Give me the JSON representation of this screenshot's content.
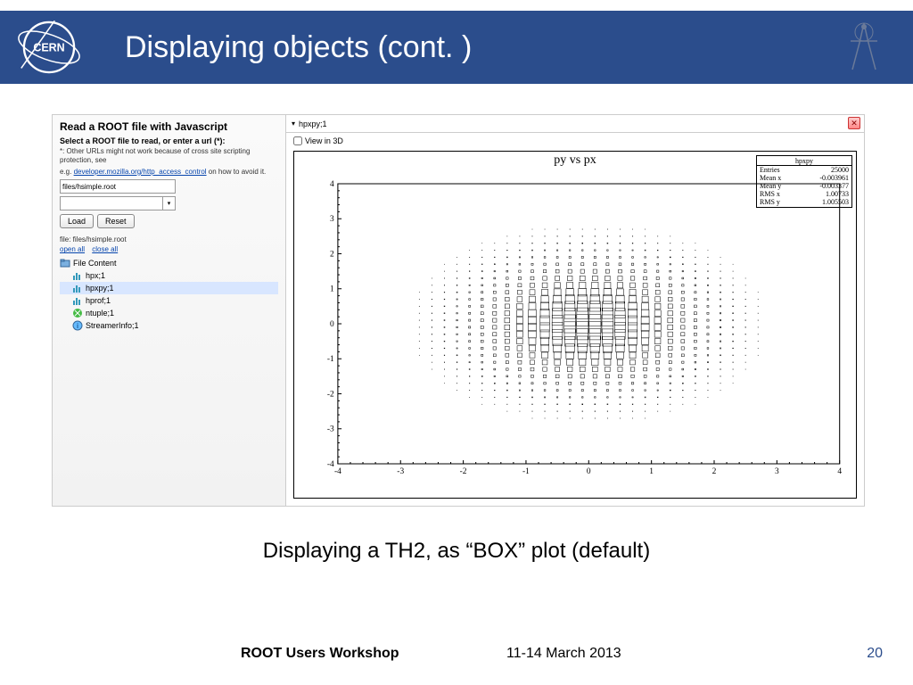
{
  "header": {
    "title": "Displaying objects (cont. )"
  },
  "left": {
    "title": "Read a ROOT file with Javascript",
    "subtitle": "Select a ROOT file to read, or enter a url (*):",
    "note1": "*: Other URLs might not work because of cross site scripting protection, see",
    "note_link": "developer.mozilla.org/http_access_control",
    "note2": " on how to avoid it.",
    "url_value": "files/hsimple.root",
    "load": "Load",
    "reset": "Reset",
    "file_label": "file: files/hsimple.root",
    "open_all": "open all",
    "close_all": "close all",
    "tree": {
      "root": "File Content",
      "items": [
        "hpx;1",
        "hpxpy;1",
        "hprof;1",
        "ntuple;1",
        "StreamerInfo;1"
      ],
      "selected_index": 1
    }
  },
  "right": {
    "obj_name": "hpxpy;1",
    "view3d_label": "View in 3D",
    "close": "✕"
  },
  "chart_data": {
    "type": "scatter",
    "title": "py vs px",
    "xlabel": "",
    "ylabel": "",
    "xlim": [
      -4,
      4
    ],
    "ylim": [
      -4,
      4
    ],
    "xticks": [
      -4,
      -3,
      -2,
      -1,
      0,
      1,
      2,
      3,
      4
    ],
    "yticks": [
      -4,
      -3,
      -2,
      -1,
      0,
      1,
      2,
      3,
      4
    ],
    "stats": {
      "name": "hpxpy",
      "entries": 25000,
      "mean_x": -0.003961,
      "mean_y": -0.003377,
      "rms_x": 1.00733,
      "rms_y": 1.005503
    },
    "description": "2D histogram TH2 rendered as BOX plot; gaussian-distributed density of boxes centered at (0,0), box size proportional to bin content."
  },
  "caption": "Displaying a TH2, as “BOX” plot (default)",
  "footer": {
    "left": "ROOT Users Workshop",
    "mid": "11-14 March 2013",
    "page": "20"
  }
}
